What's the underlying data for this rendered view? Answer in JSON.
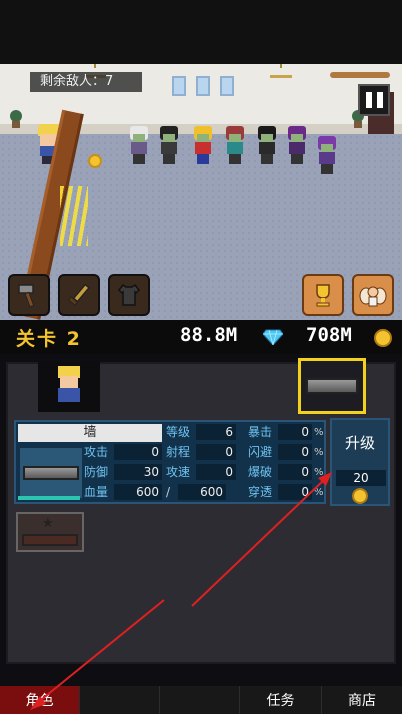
{
  "hud": {
    "enemies_label": "剩余敌人：7",
    "enemies_remaining": 7
  },
  "status": {
    "level_label": "关卡 2",
    "gems": "88.8M",
    "gold": "708M"
  },
  "item": {
    "name": "墙",
    "upgrade_label": "升级",
    "upgrade_cost": "20"
  },
  "stats": {
    "level": {
      "label": "等级",
      "value": "6"
    },
    "attack": {
      "label": "攻击",
      "value": "0"
    },
    "range": {
      "label": "射程",
      "value": "0"
    },
    "defense": {
      "label": "防御",
      "value": "30"
    },
    "attack_speed": {
      "label": "攻速",
      "value": "0"
    },
    "hp": {
      "label": "血量",
      "current": "600",
      "max": "600"
    },
    "crit": {
      "label": "暴击",
      "value": "0",
      "unit": "%"
    },
    "dodge": {
      "label": "闪避",
      "value": "0",
      "unit": "%"
    },
    "burst": {
      "label": "爆破",
      "value": "0",
      "unit": "%"
    },
    "pierce": {
      "label": "穿透",
      "value": "0",
      "unit": "%"
    }
  },
  "nav": [
    {
      "label": "角色",
      "active": true
    },
    {
      "label": "",
      "active": false
    },
    {
      "label": "",
      "active": false
    },
    {
      "label": "任务",
      "active": false
    },
    {
      "label": "商店",
      "active": false
    }
  ],
  "colors": {
    "accent_gold": "#f4c430",
    "highlight_border": "#f2d21a",
    "active_tab": "#7a0e0e",
    "stat_label": "#6fc3f0",
    "annotation_arrow": "#e02020"
  },
  "icons": [
    "pause-icon",
    "hammer-icon",
    "sword-icon",
    "shirt-icon",
    "trophy-icon",
    "angel-icon",
    "gem-icon",
    "coin-icon",
    "star-icon"
  ]
}
